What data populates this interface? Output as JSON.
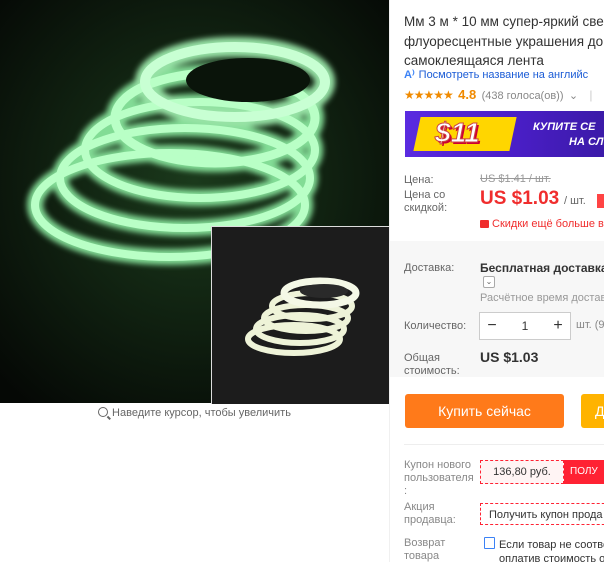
{
  "product": {
    "title_lines": [
      "Мм 3 м * 10 мм супер-яркий све",
      "флуоресцентные украшения до",
      "самоклеящаяся лента"
    ],
    "translate_link": "Посмотреть название на английс",
    "rating": {
      "stars": "★★★★★",
      "score": "4.8",
      "reviews": "(438 голоса(ов))",
      "reviews_chevron": "⌄",
      "separator": "|"
    },
    "zoom_hint": "Наведите курсор, чтобы увеличить"
  },
  "banner": {
    "amount": "$11",
    "line1": "КУПИТЕ СЕ",
    "line2": "НА СЛ"
  },
  "price": {
    "label": "Цена:",
    "old": "US $1.41 / шт.",
    "discount_label": [
      "Цена со",
      "скидкой:"
    ],
    "new": "US $1.03",
    "per_unit": "/ шт.",
    "more_discounts": "Скидки ещё больше в"
  },
  "shipping": {
    "label": "Доставка:",
    "value": "Бесплатная доставка в",
    "chevron": "⌄",
    "time": "Расчётное время доставк"
  },
  "quantity": {
    "label": "Количество:",
    "minus": "−",
    "value": "1",
    "plus": "+",
    "unit": "шт. (9"
  },
  "total": {
    "label": [
      "Общая",
      "стоимость:"
    ],
    "value": "US $1.03"
  },
  "actions": {
    "buy_now": "Купить сейчас",
    "add_to_cart": "Д"
  },
  "coupons": {
    "new_user_label": [
      "Купон нового",
      "пользователя",
      ":"
    ],
    "new_user_amount": "136,80 руб.",
    "new_user_get": "ПОЛУ",
    "seller_label": [
      "Акция",
      "продавца:"
    ],
    "seller_get": "Получить купон прода"
  },
  "returns": {
    "label": [
      "Возврат",
      "товара"
    ],
    "text_lines": [
      "Если товар не соотве",
      "оплатив стоимость о"
    ]
  },
  "colors": {
    "accent_red": "#f02d2d",
    "buy_orange": "#ff7a1a",
    "cart_yellow": "#ffb300",
    "banner_purple": "#4a1ec7",
    "star_orange": "#f08a00"
  }
}
